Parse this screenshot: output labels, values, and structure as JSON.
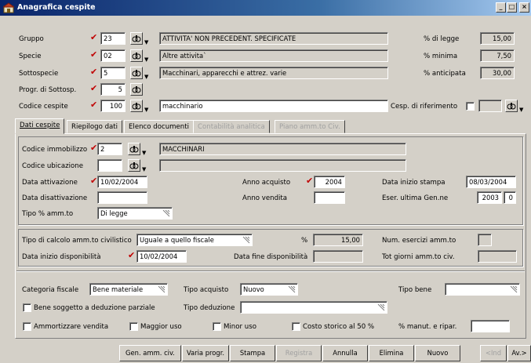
{
  "window": {
    "title": "Anagrafica cespite",
    "controls": {
      "minimize": "_",
      "maximize": "□",
      "close": "×"
    }
  },
  "header": {
    "gruppo": {
      "label": "Gruppo",
      "code": "23",
      "desc": "ATTIVITA' NON PRECEDENT. SPECIFICATE"
    },
    "specie": {
      "label": "Specie",
      "code": "02",
      "desc": "Altre attivita`"
    },
    "sottospecie": {
      "label": "Sottospecie",
      "code": "5",
      "desc": "Macchinari, apparecchi e attrez. varie"
    },
    "progr": {
      "label": "Progr. di Sottosp.",
      "value": "5"
    },
    "codice": {
      "label": "Codice cespite",
      "value": "100",
      "desc": "macchinario"
    },
    "cesp_rif_label": "Cesp. di riferimento",
    "perc_legge": {
      "label": "% di legge",
      "value": "15,00"
    },
    "perc_minima": {
      "label": "% minima",
      "value": "7,50"
    },
    "perc_anticipata": {
      "label": "% anticipata",
      "value": "30,00"
    }
  },
  "tabs": [
    {
      "label": "Dati cespite",
      "active": true
    },
    {
      "label": "Riepilogo dati"
    },
    {
      "label": "Elenco documenti"
    },
    {
      "label": "Contabilità analitica",
      "disabled": true
    },
    {
      "label": "Piano amm.to Civ.",
      "disabled": true
    }
  ],
  "dati": {
    "codice_immobilizzo": {
      "label": "Codice immobilizzo",
      "value": "2",
      "desc": "MACCHINARI"
    },
    "codice_ubicazione": {
      "label": "Codice ubicazione",
      "value": "",
      "desc": ""
    },
    "data_attivazione": {
      "label": "Data attivazione",
      "value": "10/02/2004"
    },
    "data_disattivazione": {
      "label": "Data disattivazione",
      "value": ""
    },
    "tipo_perc": {
      "label": "Tipo % amm.to",
      "value": "Di legge"
    },
    "anno_acquisto": {
      "label": "Anno acquisto",
      "value": "2004"
    },
    "anno_vendita": {
      "label": "Anno vendita",
      "value": ""
    },
    "data_inizio_stampa": {
      "label": "Data inizio stampa",
      "value": "08/03/2004"
    },
    "eser_ultima": {
      "label": "Eser. ultima Gen.ne",
      "year": "2003",
      "num": "0"
    }
  },
  "civilistico": {
    "tipo_calcolo": {
      "label": "Tipo di calcolo amm.to civilistico",
      "value": "Uguale a quello fiscale"
    },
    "perc": {
      "label": "%",
      "value": "15,00"
    },
    "num_esercizi_label": "Num. esercizi amm.to",
    "data_inizio_disp": {
      "label": "Data inizio disponibilità",
      "value": "10/02/2004"
    },
    "data_fine_disp_label": "Data fine disponibilità",
    "tot_giorni_label": "Tot giorni amm.to civ."
  },
  "fiscale": {
    "categoria": {
      "label": "Categoria fiscale",
      "value": "Bene materiale"
    },
    "tipo_acquisto": {
      "label": "Tipo acquisto",
      "value": "Nuovo"
    },
    "tipo_bene_label": "Tipo bene",
    "deduzione_parziale_label": "Bene soggetto a deduzione parziale",
    "tipo_deduzione_label": "Tipo deduzione",
    "ammortizzare_vendita_label": "Ammortizzare vendita",
    "maggior_uso_label": "Maggior uso",
    "minor_uso_label": "Minor uso",
    "costo_storico_label": "Costo storico al 50 %",
    "manut_label": "% manut. e ripar."
  },
  "buttons": {
    "gen_amm_civ": "Gen. amm. civ.",
    "varia_progr": "Varia progr.",
    "stampa": "Stampa",
    "registra": "Registra",
    "annulla": "Annulla",
    "elimina": "Elimina",
    "nuovo": "Nuovo",
    "ind": "<Ind",
    "av": "Av.>"
  },
  "colors": {
    "title_start": "#0a246a",
    "title_end": "#a6caf0",
    "required_mark": "#c00000",
    "window_bg": "#d4d0c8"
  },
  "icons": [
    "app-icon",
    "lookup-binoculars-icon",
    "required-checkmark-icon",
    "combo-arrow-icon"
  ]
}
